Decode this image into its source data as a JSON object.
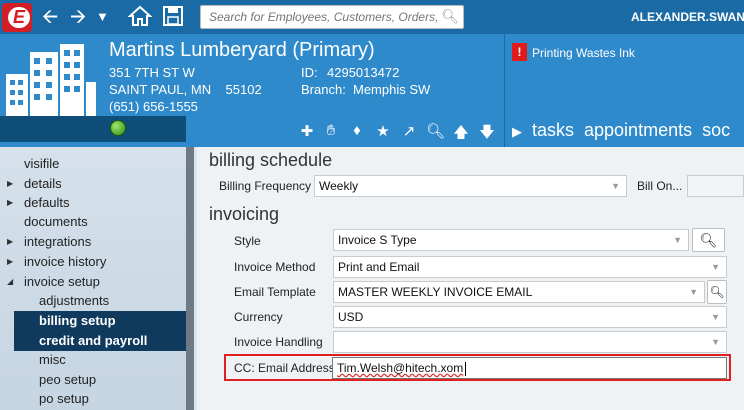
{
  "toolbar": {
    "search_placeholder": "Search for Employees, Customers, Orders, etc.",
    "user": "ALEXANDER.SWANSO"
  },
  "header": {
    "company": "Martins Lumberyard (Primary)",
    "address1": "351 7TH ST W",
    "address2": "SAINT PAUL, MN    55102",
    "phone": "(651) 656-1555",
    "id_label": "ID:",
    "id_value": "4295013472",
    "branch_label": "Branch:",
    "branch_value": "Memphis SW",
    "alert_icon": "!",
    "alert_text": "Printing Wastes Ink",
    "tabs": [
      "tasks",
      "appointments",
      "soc"
    ]
  },
  "sidebar": {
    "items": [
      {
        "label": "visifile",
        "arrow": ""
      },
      {
        "label": "details",
        "arrow": "▶"
      },
      {
        "label": "defaults",
        "arrow": "▶"
      },
      {
        "label": "documents",
        "arrow": ""
      },
      {
        "label": "integrations",
        "arrow": "▶"
      },
      {
        "label": "invoice history",
        "arrow": "▶"
      },
      {
        "label": "invoice setup",
        "arrow": "◢"
      },
      {
        "label": "adjustments",
        "arrow": ""
      },
      {
        "label": "billing setup",
        "arrow": ""
      },
      {
        "label": "credit and payroll",
        "arrow": ""
      },
      {
        "label": "misc",
        "arrow": ""
      },
      {
        "label": "peo setup",
        "arrow": ""
      },
      {
        "label": "po setup",
        "arrow": ""
      }
    ]
  },
  "main": {
    "billing_schedule_title": "billing schedule",
    "billing_frequency_label": "Billing Frequency",
    "billing_frequency_value": "Weekly",
    "bill_on_label": "Bill On...",
    "invoicing_title": "invoicing",
    "style_label": "Style",
    "style_value": "Invoice S Type",
    "invoice_method_label": "Invoice Method",
    "invoice_method_value": "Print and Email",
    "email_template_label": "Email Template",
    "email_template_value": "MASTER WEEKLY INVOICE EMAIL",
    "currency_label": "Currency",
    "currency_value": "USD",
    "invoice_handling_label": "Invoice Handling",
    "invoice_handling_value": "",
    "cc_email_label": "CC: Email Address",
    "cc_email_value": "Tim.Welsh@hitech.xom"
  },
  "colors": {
    "toolbar_bg": "#1a6aa5",
    "header_bg": "#2f8acb",
    "selected_nav": "#0f3a5e",
    "highlight": "#e02020"
  }
}
